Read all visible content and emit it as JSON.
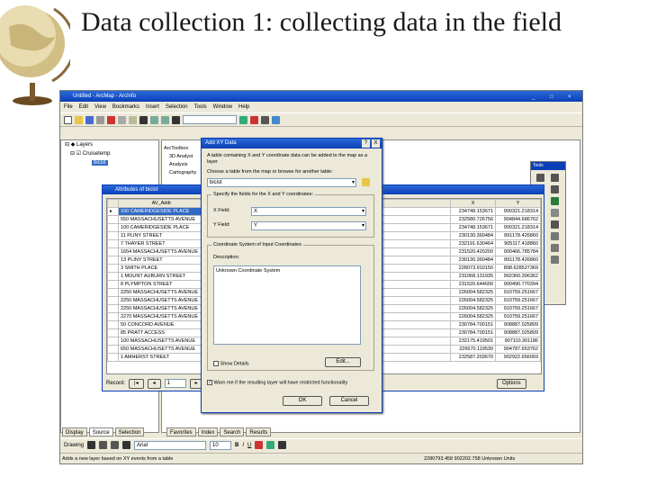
{
  "slide": {
    "title": "Data collection 1: collecting data in the field"
  },
  "window": {
    "title": "Untitled - ArcMap - ArcInfo",
    "menu": [
      "File",
      "Edit",
      "View",
      "Bookmarks",
      "Insert",
      "Selection",
      "Tools",
      "Window",
      "Help"
    ]
  },
  "toc": {
    "rows": [
      "Layers",
      "Cruisetemp",
      "bicist"
    ],
    "tabs": [
      "Display",
      "Source",
      "Selection"
    ]
  },
  "arctoolbox": {
    "rows": [
      "ArcToolbox",
      "3D Analyst",
      "Analysis",
      "Cartography"
    ]
  },
  "catalog_tabs": [
    "Favorites",
    "Index",
    "Search",
    "Results"
  ],
  "tools": {
    "title": "Tools"
  },
  "attributes": {
    "title": "Attributes of bicist",
    "columns": [
      "",
      "AV_Addr",
      "",
      "X",
      "Y"
    ],
    "rows": [
      [
        "100 CAMERIDGESIDE PLACE",
        "234748.153671",
        "900321.218314"
      ],
      [
        "550 MASSACHUSETTS AVENUE",
        "232580.726756",
        "904844.686762"
      ],
      [
        "100 CAMERIDGESIDE PLACE",
        "234748.153671",
        "900321.218314"
      ],
      [
        "11 PLINY STREET",
        "230130.360484",
        "891178.426860"
      ],
      [
        "7 THAYER STREET",
        "232191.630464",
        "905117.418860"
      ],
      [
        "1654 MASSACHUSETTS AVENUE",
        "231520.420200",
        "900466.785784"
      ],
      [
        "13 PLINY STREET",
        "230130.360484",
        "891178.426860"
      ],
      [
        "3 SMITH PLACE",
        "228073.910150",
        "898.628527369"
      ],
      [
        "1 MOUNT AUBURN STREET",
        "231068.131935",
        "902360.396362"
      ],
      [
        "8 PLYMPTON STREET",
        "231520.644600",
        "900490.770394"
      ],
      [
        "2250 MASSACHUSETTS AVENUE",
        "226004.582325",
        "910759.251667"
      ],
      [
        "2250 MASSACHUSETTS AVENUE",
        "226004.582325",
        "910759.251667"
      ],
      [
        "2250 MASSACHUSETTS AVENUE",
        "226004.582325",
        "910759.251667"
      ],
      [
        "2270 MASSACHUSETTS AVENUE",
        "226004.582325",
        "910759.251667"
      ],
      [
        "50 CONCORD AVENUE",
        "230784.700151",
        "908887.025809"
      ],
      [
        "85 PRATT ACCESS",
        "230784.700151",
        "908887.025809"
      ],
      [
        "100 MASSACHUSETTS AVENUE",
        "232175.419501",
        "907110.301186"
      ],
      [
        "650 MASSACHUSETTS AVENUE",
        "226670.119530",
        "904787.653762"
      ],
      [
        "1 AMHERST STREET",
        "232587.203670",
        "902922.656069"
      ]
    ],
    "record_label": "Record:",
    "record_value": "1",
    "options_label": "Options"
  },
  "dialog": {
    "title": "Add XY Data",
    "intro": "A table containing X and Y coordinate data can be added to the map as a layer",
    "choose_label": "Choose a table from the map or browse for another table:",
    "table_value": "bicist",
    "fields_group": "Specify the fields for the X and Y coordinates:",
    "xfield_label": "X Field:",
    "xfield_value": "X",
    "yfield_label": "Y Field:",
    "yfield_value": "Y",
    "coord_group": "Coordinate System of Input Coordinates",
    "description_label": "Description:",
    "description_value": "Unknown Coordinate System",
    "show_details": "Show Details",
    "edit_button": "Edit...",
    "warn_label": "Warn me if the resulting layer will have restricted functionality",
    "ok_button": "OK",
    "cancel_button": "Cancel",
    "help_glyph": "?",
    "close_glyph": "X"
  },
  "drawbar": {
    "drawing": "Drawing",
    "font": "Arial",
    "size": "10"
  },
  "status": {
    "text": "Adds a new layer based on XY events from a table",
    "coords": "2280793.458  902202.758 Unknown Units"
  }
}
